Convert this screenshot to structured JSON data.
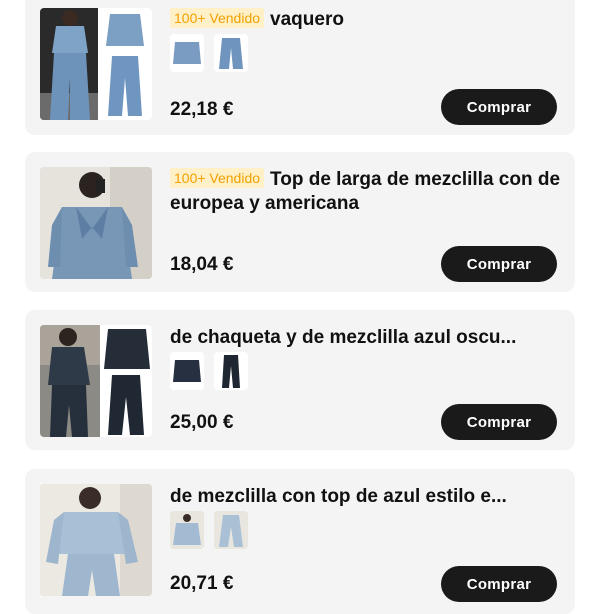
{
  "products": [
    {
      "badge": "100+ Vendido",
      "title": "vaquero",
      "price": "22,18 €",
      "buy_label": "Comprar",
      "image": "denim-jacket-wide-jeans-photo",
      "thumbs": [
        "denim-jacket-thumb",
        "wide-jeans-thumb"
      ]
    },
    {
      "badge": "100+ Vendido",
      "title": "Top de larga de mezclilla con de europea y americana",
      "price": "18,04 €",
      "buy_label": "Comprar",
      "image": "denim-bow-top-photo",
      "thumbs": []
    },
    {
      "badge": "",
      "title": "de chaqueta y de mezclilla azul oscu...",
      "price": "25,00 €",
      "buy_label": "Comprar",
      "image": "dark-denim-set-photo",
      "thumbs": [
        "dark-jacket-thumb",
        "dark-jeans-thumb"
      ]
    },
    {
      "badge": "",
      "title": "de mezclilla con top de azul estilo e...",
      "price": "20,71 €",
      "buy_label": "Comprar",
      "image": "light-denim-set-photo",
      "thumbs": [
        "light-denim-top-thumb",
        "light-denim-jeans-thumb"
      ]
    }
  ],
  "colors": {
    "card_bg": "#f4f4f4",
    "badge_bg": "#fff0c8",
    "badge_text": "#f2a100",
    "button_bg": "#1a1a1a"
  }
}
